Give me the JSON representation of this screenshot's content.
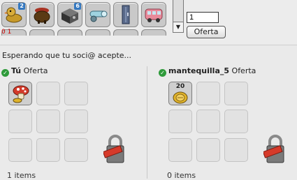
{
  "inventory": {
    "slots": [
      {
        "name": "inv-item-duck",
        "badge": "2"
      },
      {
        "name": "inv-item-cauldron",
        "badge": ""
      },
      {
        "name": "inv-item-safe",
        "badge": "6"
      },
      {
        "name": "inv-item-cannon",
        "badge": ""
      },
      {
        "name": "inv-item-locker",
        "badge": ""
      },
      {
        "name": "inv-item-van",
        "badge": ""
      }
    ],
    "zero_marker": "0 1"
  },
  "trade": {
    "quantity_value": "1",
    "offer_button_label": "Oferta",
    "status": "Esperando que tu soci@ acepte...",
    "left": {
      "user": "Tú",
      "offer_label": "Oferta",
      "items_count": "1 items"
    },
    "right": {
      "user": "mantequilla_5",
      "offer_label": "Oferta",
      "items_count": "0 items",
      "stack_count": "20"
    }
  },
  "colors": {
    "accept_check": "#2e9a3a",
    "lock_tag": "#d63a2a"
  }
}
